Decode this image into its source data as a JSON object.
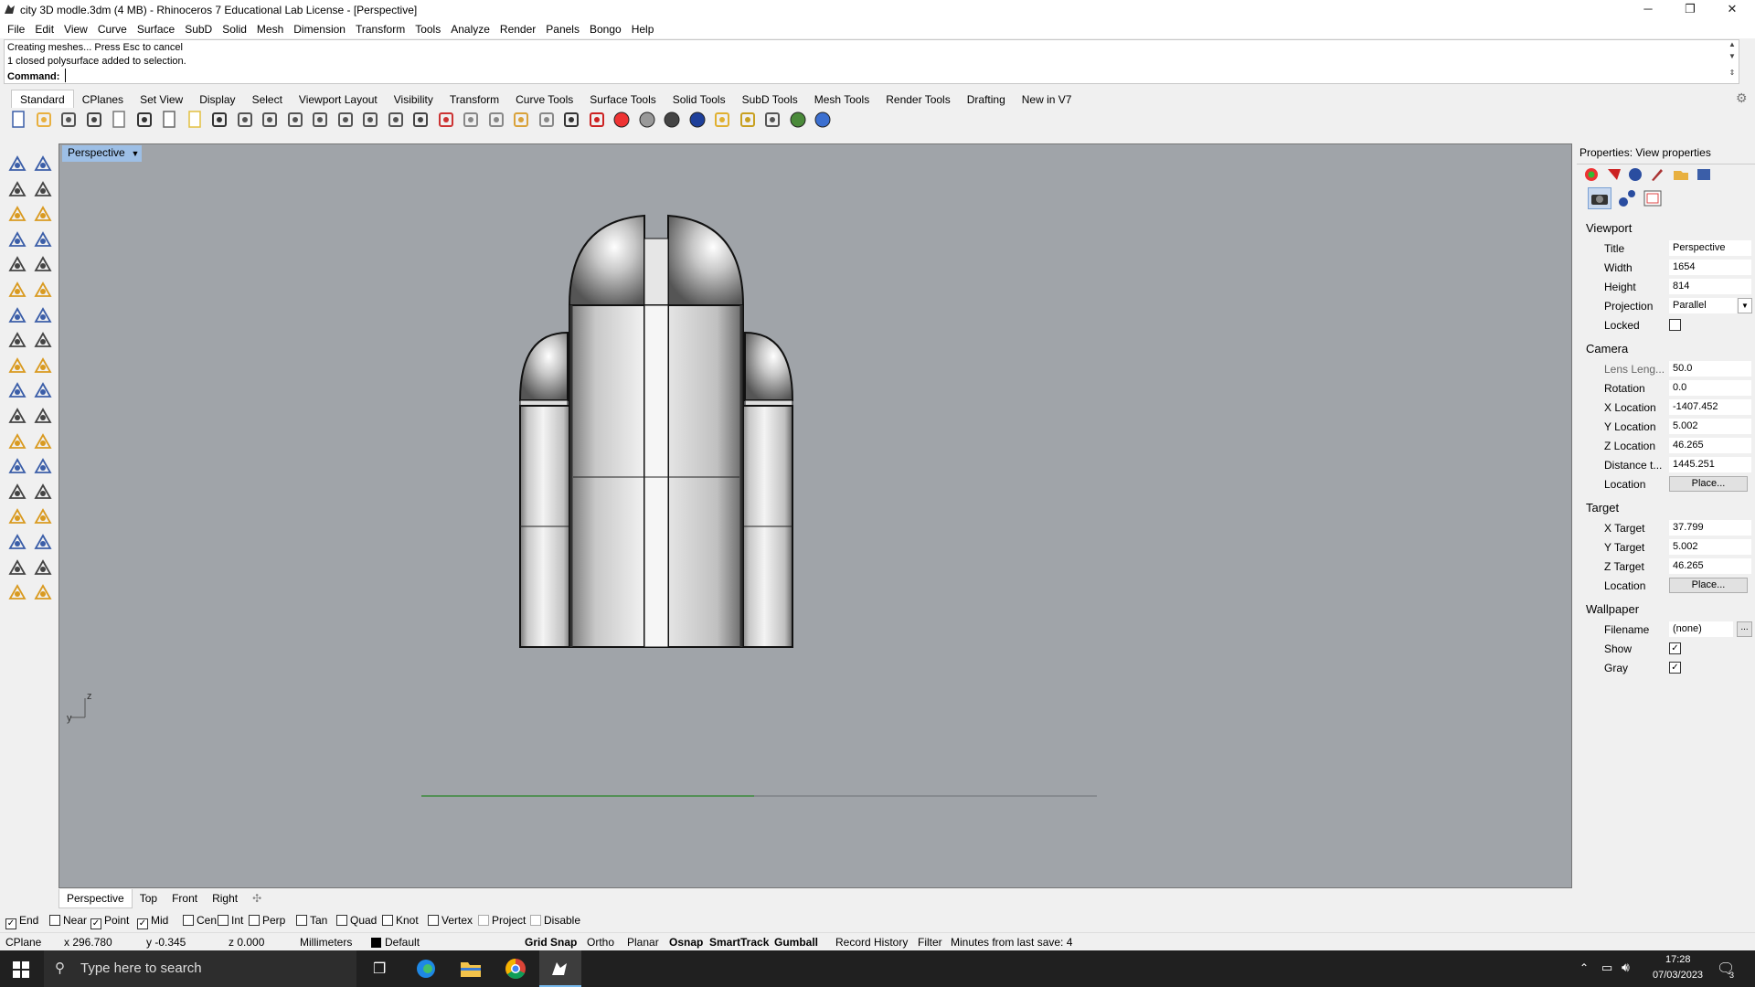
{
  "window": {
    "title": "city 3D modle.3dm (4 MB) - Rhinoceros 7 Educational Lab License - [Perspective]",
    "minimize": "─",
    "restore": "❐",
    "close": "✕"
  },
  "menu": [
    "File",
    "Edit",
    "View",
    "Curve",
    "Surface",
    "SubD",
    "Solid",
    "Mesh",
    "Dimension",
    "Transform",
    "Tools",
    "Analyze",
    "Render",
    "Panels",
    "Bongo",
    "Help"
  ],
  "command": {
    "history": [
      "Creating meshes... Press Esc to cancel",
      "1 closed polysurface added to selection."
    ],
    "prompt": "Command:"
  },
  "tabs": [
    "Standard",
    "CPlanes",
    "Set View",
    "Display",
    "Select",
    "Viewport Layout",
    "Visibility",
    "Transform",
    "Curve Tools",
    "Surface Tools",
    "Solid Tools",
    "SubD Tools",
    "Mesh Tools",
    "Render Tools",
    "Drafting",
    "New in V7"
  ],
  "toolbar_icons": [
    "new-file-icon",
    "open-icon",
    "save-icon",
    "print-icon",
    "import-icon",
    "cut-icon",
    "copy-icon",
    "paste-icon",
    "undo-icon",
    "pan-icon",
    "move-view-icon",
    "zoom-icon",
    "zoom-window-icon",
    "zoom-extents-icon",
    "zoom-selected-icon",
    "rotate-view-icon",
    "four-viewports-icon",
    "car-icon",
    "cplane-icon",
    "circle-icon",
    "snap-icon",
    "light-bulb-icon",
    "lock-icon",
    "layer-icon",
    "color-wheel-icon",
    "material-ball-icon",
    "render-sphere-icon",
    "blue-sphere-icon",
    "filter-icon",
    "gear-icon",
    "dimension-icon",
    "globe-icon",
    "help-icon"
  ],
  "viewport": {
    "label": "Perspective",
    "axis_z": "z",
    "axis_y": "y",
    "tabs": [
      "Perspective",
      "Top",
      "Front",
      "Right"
    ],
    "add_tab": "✣"
  },
  "osnaps": [
    {
      "label": "End",
      "checked": true
    },
    {
      "label": "Near",
      "checked": false
    },
    {
      "label": "Point",
      "checked": true
    },
    {
      "label": "Mid",
      "checked": true
    },
    {
      "label": "Cen",
      "checked": false
    },
    {
      "label": "Int",
      "checked": false
    },
    {
      "label": "Perp",
      "checked": false
    },
    {
      "label": "Tan",
      "checked": false
    },
    {
      "label": "Quad",
      "checked": false
    },
    {
      "label": "Knot",
      "checked": false
    },
    {
      "label": "Vertex",
      "checked": false
    },
    {
      "label": "Project",
      "checked": false
    },
    {
      "label": "Disable",
      "checked": false
    }
  ],
  "status": {
    "cplane": "CPlane",
    "x": "x 296.780",
    "y": "y -0.345",
    "z": "z 0.000",
    "units": "Millimeters",
    "layer": "Default",
    "layer_color": "#000000",
    "toggles": [
      {
        "label": "Grid Snap",
        "bold": true
      },
      {
        "label": "Ortho",
        "bold": false
      },
      {
        "label": "Planar",
        "bold": false
      },
      {
        "label": "Osnap",
        "bold": true
      },
      {
        "label": "SmartTrack",
        "bold": true
      },
      {
        "label": "Gumball",
        "bold": true
      },
      {
        "label": "Record History",
        "bold": false
      },
      {
        "label": "Filter",
        "bold": false
      }
    ],
    "save_msg": "Minutes from last save: 4"
  },
  "properties": {
    "header": "Properties: View properties",
    "viewport_section": "Viewport",
    "title_label": "Title",
    "title_value": "Perspective",
    "width_label": "Width",
    "width_value": "1654",
    "height_label": "Height",
    "height_value": "814",
    "projection_label": "Projection",
    "projection_value": "Parallel",
    "locked_label": "Locked",
    "camera_section": "Camera",
    "lens_label": "Lens Leng...",
    "lens_value": "50.0",
    "rotation_label": "Rotation",
    "rotation_value": "0.0",
    "xloc_label": "X Location",
    "xloc_value": "-1407.452",
    "yloc_label": "Y Location",
    "yloc_value": "5.002",
    "zloc_label": "Z Location",
    "zloc_value": "46.265",
    "dist_label": "Distance t...",
    "dist_value": "1445.251",
    "location_label": "Location",
    "place_button": "Place...",
    "target_section": "Target",
    "xt_label": "X Target",
    "xt_value": "37.799",
    "yt_label": "Y Target",
    "yt_value": "5.002",
    "zt_label": "Z Target",
    "zt_value": "46.265",
    "tlocation_label": "Location",
    "tplace_button": "Place...",
    "wallpaper_section": "Wallpaper",
    "filename_label": "Filename",
    "filename_value": "(none)",
    "browse_button": "...",
    "show_label": "Show",
    "gray_label": "Gray"
  },
  "taskbar": {
    "search_placeholder": "Type here to search",
    "time": "17:28",
    "date": "07/03/2023",
    "notifications": "3"
  }
}
